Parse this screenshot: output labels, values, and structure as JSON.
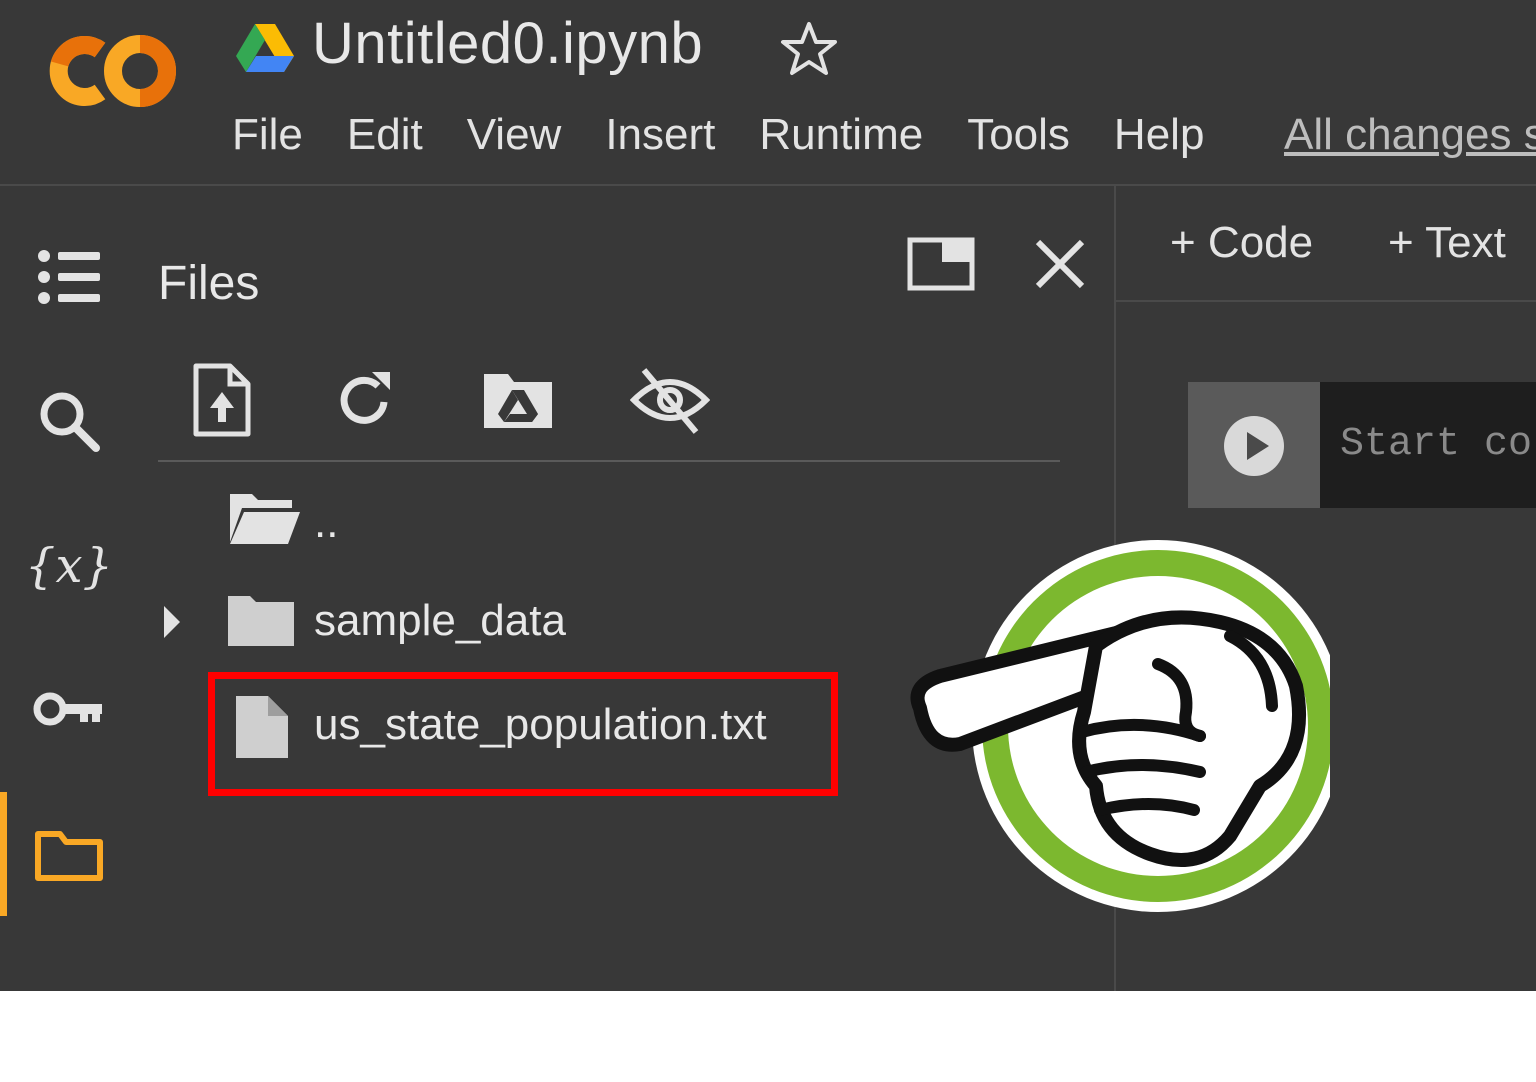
{
  "notebook": {
    "title": "Untitled0.ipynb",
    "save_status": "All changes s"
  },
  "menu": [
    "File",
    "Edit",
    "View",
    "Insert",
    "Runtime",
    "Tools",
    "Help"
  ],
  "sidebar": {
    "rail_icons": [
      "table-of-contents-icon",
      "search-icon",
      "variables-icon",
      "key-icon",
      "folder-icon"
    ],
    "active": "folder-icon"
  },
  "files_panel": {
    "title": "Files",
    "toolbar": [
      "upload-file-icon",
      "refresh-icon",
      "mount-drive-icon",
      "toggle-hidden-files-icon"
    ],
    "entries": [
      {
        "name": "..",
        "type": "parent-folder"
      },
      {
        "name": "sample_data",
        "type": "folder",
        "expandable": true
      },
      {
        "name": "us_state_population.txt",
        "type": "file",
        "highlighted": true
      }
    ]
  },
  "notebook_area": {
    "add_code": "+ Code",
    "add_text": "+ Text",
    "cell_placeholder": "Start co"
  },
  "colors": {
    "background": "#383838",
    "accent_orange": "#f9a825",
    "highlight_red": "#ff0000",
    "badge_green": "#7cb82f"
  }
}
